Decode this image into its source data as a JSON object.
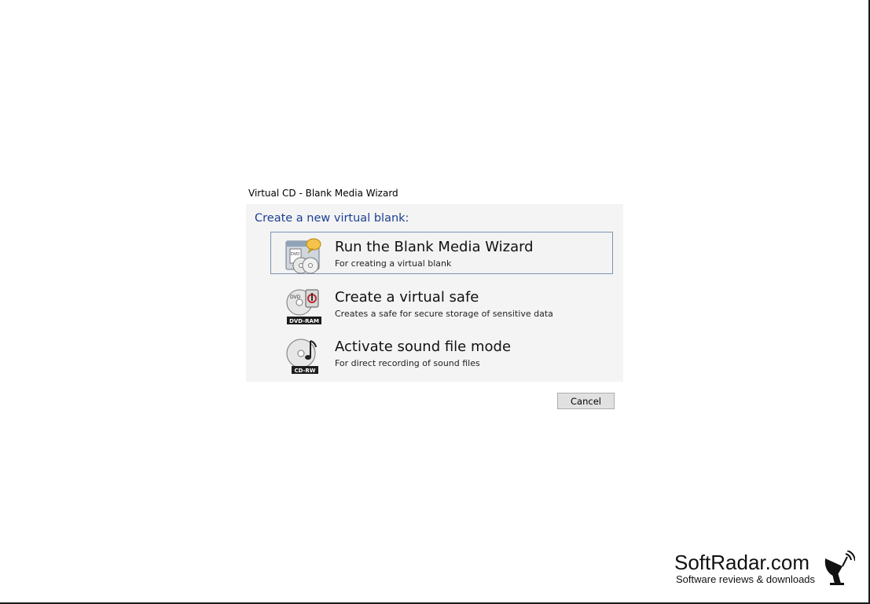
{
  "window": {
    "title": "Virtual CD - Blank Media Wizard"
  },
  "instruction": "Create a new virtual blank:",
  "commands": [
    {
      "title": "Run the Blank Media Wizard",
      "subtitle": "For creating a virtual blank",
      "icon": "dvd-wizard-icon",
      "badge": ""
    },
    {
      "title": "Create a virtual safe",
      "subtitle": "Creates a safe for secure storage of sensitive data",
      "icon": "dvd-ram-safe-icon",
      "badge": "DVD-RAM"
    },
    {
      "title": "Activate sound file mode",
      "subtitle": "For direct recording of sound files",
      "icon": "cd-rw-music-icon",
      "badge": "CD-RW"
    }
  ],
  "buttons": {
    "cancel": "Cancel"
  },
  "watermark": {
    "name": "SoftRadar.com",
    "tagline": "Software reviews & downloads",
    "icon": "satellite-dish-icon"
  },
  "colors": {
    "instruction": "#1c3f95",
    "selection_border": "#7a94b5",
    "panel_bg": "#f4f4f4"
  }
}
